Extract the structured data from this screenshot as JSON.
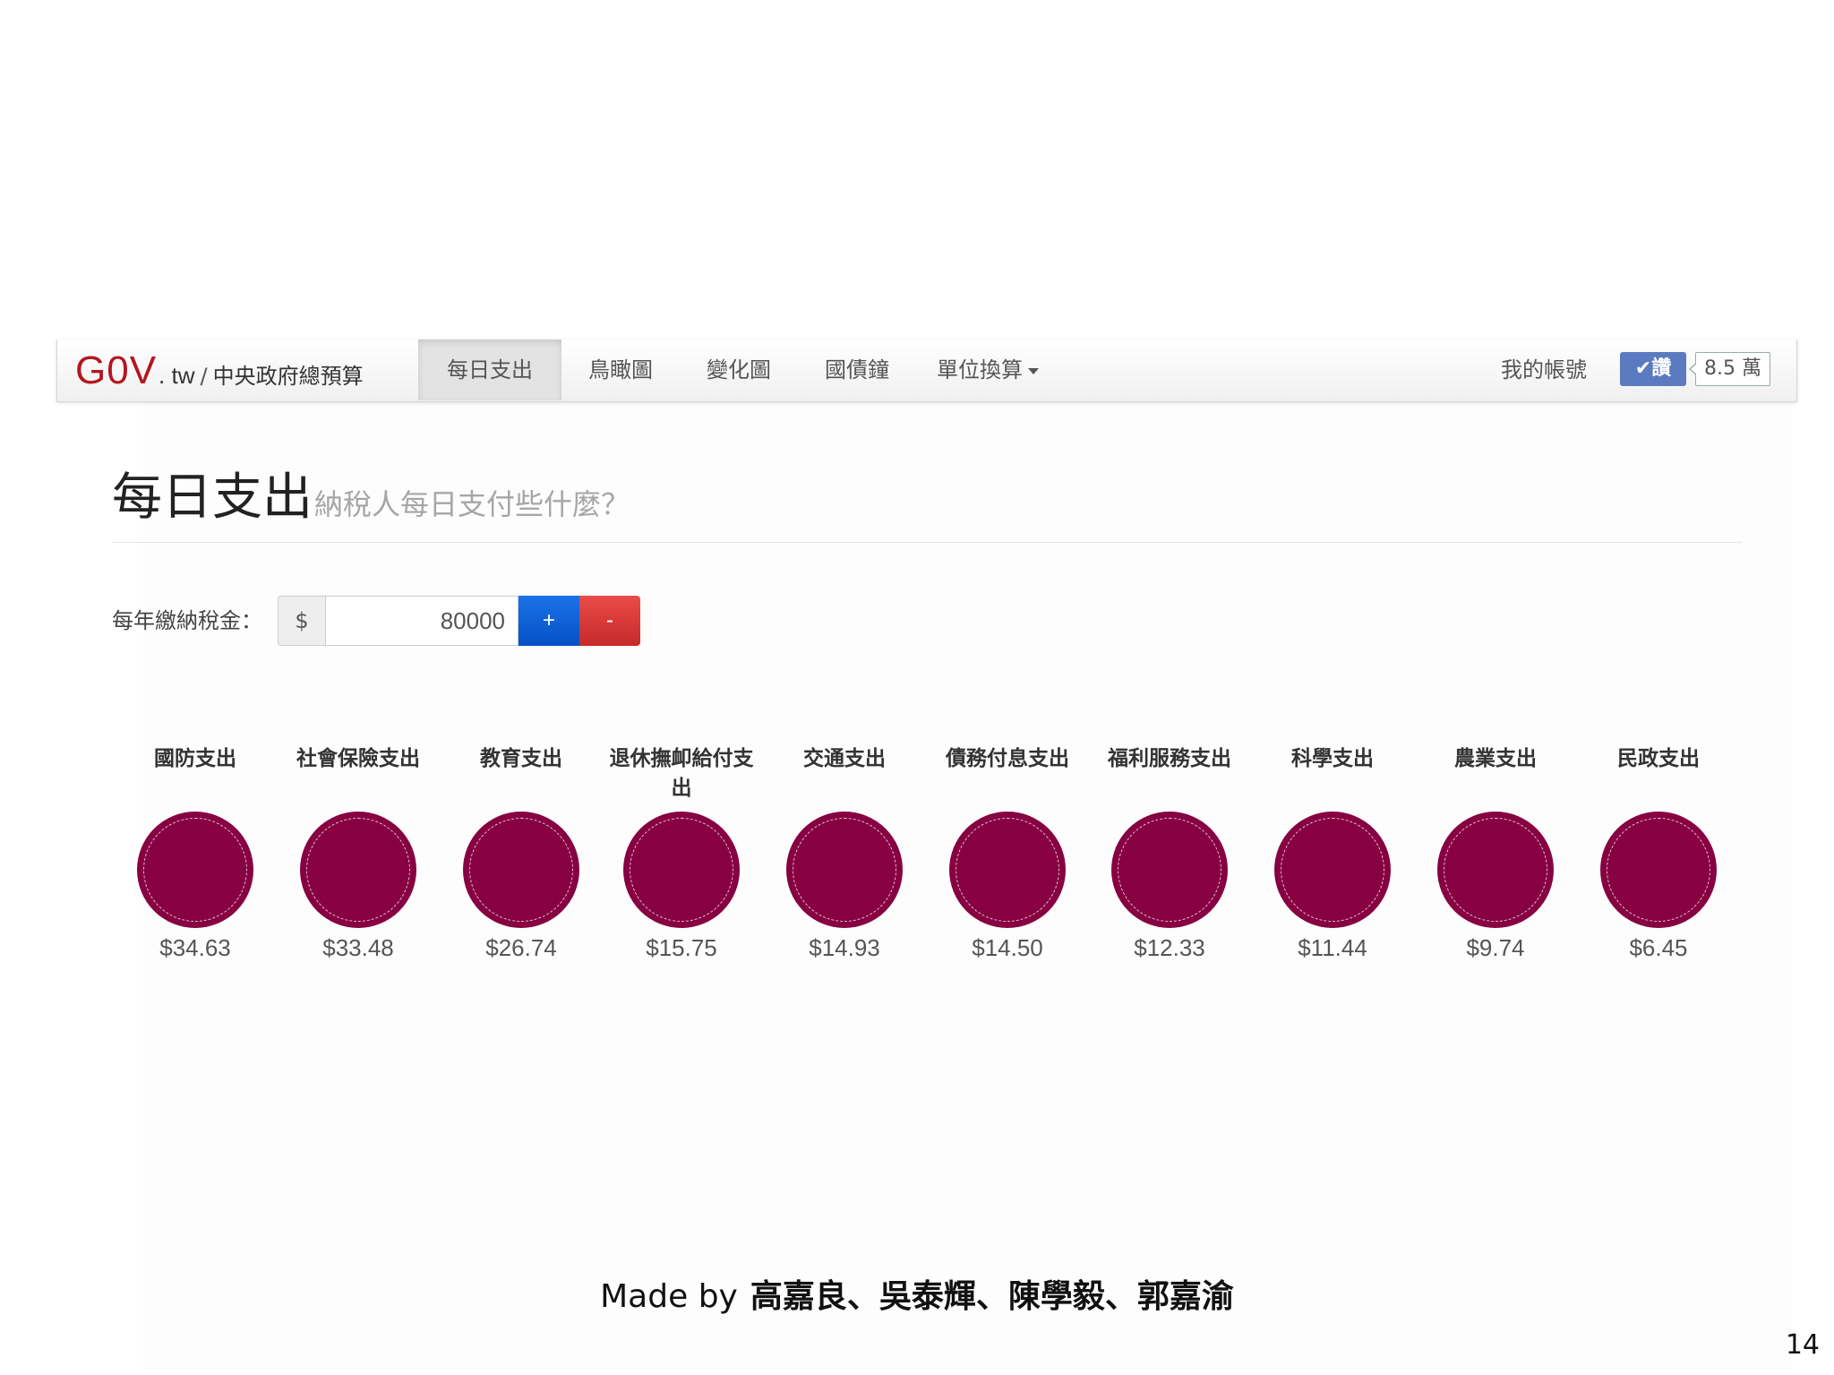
{
  "navbar": {
    "brand_logo": "G0V",
    "brand_tld": ". tw",
    "brand_sep": "/",
    "brand_sub": "中央政府總預算",
    "items": [
      {
        "label": "每日支出",
        "active": true
      },
      {
        "label": "鳥瞰圖",
        "active": false
      },
      {
        "label": "變化圖",
        "active": false
      },
      {
        "label": "國債鐘",
        "active": false
      },
      {
        "label": "單位換算",
        "active": false,
        "dropdown": true
      }
    ],
    "account": "我的帳號",
    "like_label": "✔讚",
    "like_count": "8.5 萬",
    "like_color": "#5b7bc0"
  },
  "page": {
    "title": "每日支出",
    "subtitle": "納稅人每日支付些什麼？"
  },
  "tax": {
    "label": "每年繳納稅金：",
    "prefix": "$",
    "value": "80000",
    "plus": "+",
    "minus": "-"
  },
  "categories": [
    {
      "label": "國防支出",
      "value": "$34.63"
    },
    {
      "label": "社會保險支出",
      "value": "$33.48"
    },
    {
      "label": "教育支出",
      "value": "$26.74"
    },
    {
      "label": "退休撫卹給付支出",
      "value": "$15.75"
    },
    {
      "label": "交通支出",
      "value": "$14.93"
    },
    {
      "label": "債務付息支出",
      "value": "$14.50"
    },
    {
      "label": "福利服務支出",
      "value": "$12.33"
    },
    {
      "label": "科學支出",
      "value": "$11.44"
    },
    {
      "label": "農業支出",
      "value": "$9.74"
    },
    {
      "label": "民政支出",
      "value": "$6.45"
    }
  ],
  "circle_color": "#870041",
  "footer": {
    "made_by": "Made by",
    "names": "高嘉良、吳泰輝、陳學毅、郭嘉渝"
  },
  "slide_number": "14"
}
